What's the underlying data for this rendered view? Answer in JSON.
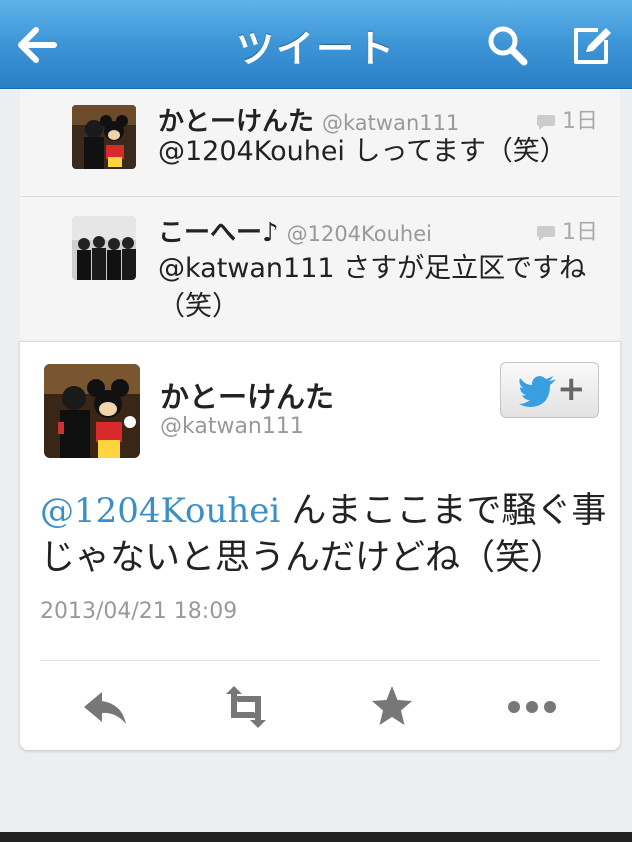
{
  "nav": {
    "title": "ツイート",
    "back_icon": "back-arrow-icon",
    "search_icon": "search-icon",
    "compose_icon": "compose-icon",
    "color": "#3d95d6"
  },
  "replies": [
    {
      "name": "かとーけんた",
      "handle": "@katwan111",
      "time": "1日",
      "text": "@1204Kouhei しってます（笑）"
    },
    {
      "name": "こーへー♪",
      "handle": "@1204Kouhei",
      "time": "1日",
      "text": "@katwan111 さすが足立区ですね（笑）"
    }
  ],
  "tweet": {
    "name": "かとーけんた",
    "handle": "@katwan111",
    "mention": "@1204Kouhei",
    "body": " んまここまで騒ぐ事じゃないと思うんだけどね（笑）",
    "date": "2013/04/21 18:09",
    "follow_plus": "+",
    "mention_color": "#3a8fc8"
  },
  "actions": {
    "reply_icon": "reply-icon",
    "retweet_icon": "retweet-icon",
    "favorite_icon": "star-icon",
    "more_icon": "more-icon"
  }
}
